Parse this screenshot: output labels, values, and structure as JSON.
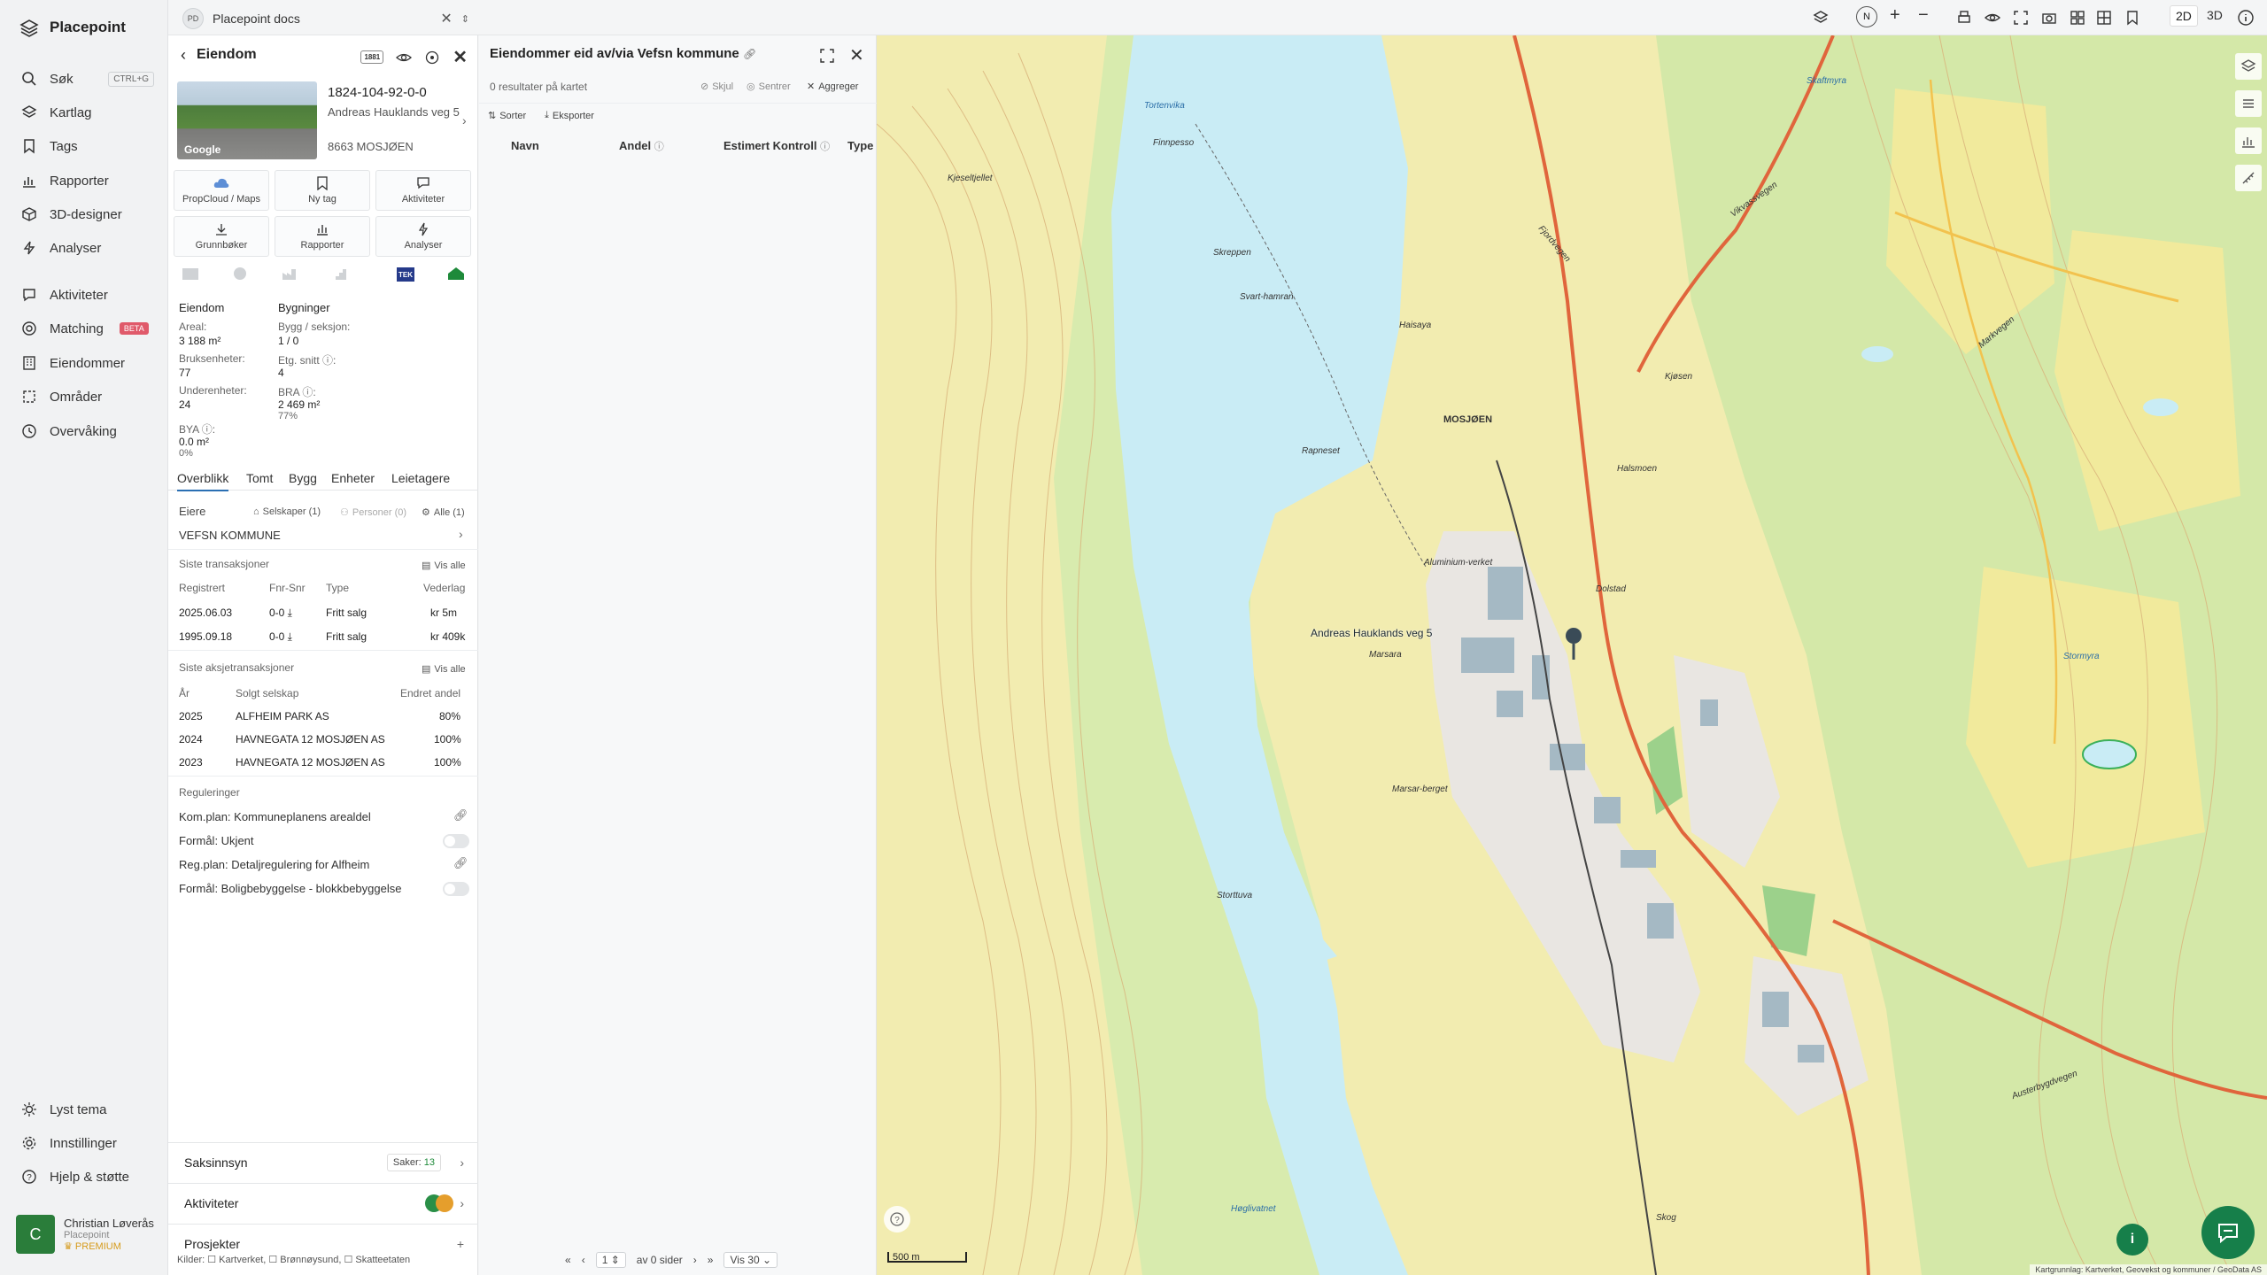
{
  "app": {
    "name": "Placepoint"
  },
  "nav": {
    "items": [
      {
        "label": "Søk",
        "shortcut": "CTRL+G"
      },
      {
        "label": "Kartlag"
      },
      {
        "label": "Tags"
      },
      {
        "label": "Rapporter"
      },
      {
        "label": "3D-designer"
      },
      {
        "label": "Analyser"
      },
      {
        "label": "Aktiviteter"
      },
      {
        "label": "Matching",
        "badge": "BETA"
      },
      {
        "label": "Eiendommer"
      },
      {
        "label": "Områder"
      },
      {
        "label": "Overvåking"
      }
    ],
    "bottom": [
      {
        "label": "Lyst tema"
      },
      {
        "label": "Innstillinger"
      },
      {
        "label": "Hjelp & støtte"
      }
    ],
    "user": {
      "initial": "C",
      "name": "Christian Løverås",
      "org": "Placepoint",
      "plan": "PREMIUM"
    }
  },
  "topbar": {
    "tab": {
      "badge": "PD",
      "title": "Placepoint docs"
    },
    "view_2d": "2D",
    "view_3d": "3D",
    "compass": "N"
  },
  "property": {
    "header": "Eiendom",
    "badge": "1881",
    "photo_logo": "Google",
    "id": "1824-104-92-0-0",
    "address": "Andreas Hauklands veg 5",
    "postal": "8663 MOSJØEN",
    "actions": [
      {
        "label": "PropCloud / Maps"
      },
      {
        "label": "Ny tag"
      },
      {
        "label": "Aktiviteter"
      },
      {
        "label": "Grunnbøker"
      },
      {
        "label": "Rapporter"
      },
      {
        "label": "Analyser"
      }
    ],
    "source_badge": "TEK",
    "summary": {
      "col1_title": "Eiendom",
      "col2_title": "Bygninger",
      "areal_label": "Areal:",
      "areal_value": "3 188 m²",
      "bruk_label": "Bruksenheter:",
      "bruk_value": "77",
      "under_label": "Underenheter:",
      "under_value": "24",
      "bya_label": "BYA ⓘ:",
      "bya_value": "0.0 m²",
      "bya_pct": "0%",
      "bygg_label": "Bygg / seksjon:",
      "bygg_value": "1 / 0",
      "etg_label": "Etg. snitt ⓘ:",
      "etg_value": "4",
      "bra_label": "BRA ⓘ:",
      "bra_value": "2 469 m²",
      "bra_pct": "77%"
    },
    "tabs": [
      "Overblikk",
      "Tomt",
      "Bygg",
      "Enheter",
      "Leietagere"
    ],
    "owners": {
      "title": "Eiere",
      "companies": "Selskaper (1)",
      "persons": "Personer (0)",
      "all": "Alle (1)",
      "owner": "VEFSN KOMMUNE"
    },
    "transactions": {
      "title": "Siste transaksjoner",
      "view_all": "Vis alle",
      "headers": [
        "Registrert",
        "Fnr-Snr",
        "Type",
        "Vederlag"
      ],
      "rows": [
        {
          "date": "2025.06.03",
          "fnr": "0-0",
          "type": "Fritt salg",
          "amount": "kr 5m"
        },
        {
          "date": "1995.09.18",
          "fnr": "0-0",
          "type": "Fritt salg",
          "amount": "kr 409k"
        }
      ]
    },
    "share_tx": {
      "title": "Siste aksjetransaksjoner",
      "view_all": "Vis alle",
      "headers": [
        "År",
        "Solgt selskap",
        "Endret andel"
      ],
      "rows": [
        {
          "year": "2025",
          "company": "ALFHEIM PARK AS",
          "share": "80%"
        },
        {
          "year": "2024",
          "company": "HAVNEGATA 12 MOSJØEN AS",
          "share": "100%"
        },
        {
          "year": "2023",
          "company": "HAVNEGATA 12 MOSJØEN AS",
          "share": "100%"
        }
      ]
    },
    "regulations": {
      "title": "Reguleringer",
      "items": [
        "Kom.plan: Kommuneplanens arealdel",
        "Formål: Ukjent",
        "Reg.plan: Detaljregulering for Alfheim",
        "Formål: Boligbebyggelse - blokkbebyggelse"
      ]
    },
    "accordions": [
      {
        "label": "Saksinnsyn",
        "extra_label": "Saker:",
        "extra_value": "13"
      },
      {
        "label": "Aktiviteter"
      },
      {
        "label": "Prosjekter"
      }
    ],
    "sources_text": "Kilder: ☐ Kartverket, ☐ Brønnøysund, ☐ Skatteetaten"
  },
  "list": {
    "title": "Eiendommer eid av/via Vefsn kommune",
    "count": "0 resultater på kartet",
    "hide": "Skjul",
    "center": "Sentrer",
    "aggregate": "Aggreger",
    "sort": "Sorter",
    "export": "Eksporter",
    "columns": [
      "Navn",
      "Andel",
      "Estimert Kontroll",
      "Type"
    ],
    "pager": {
      "page": "1",
      "of": "av 0 sider",
      "per_page": "Vis 30"
    }
  },
  "map": {
    "town": "MOSJØEN",
    "marker_label": "Andreas Hauklands veg 5",
    "scale": "500 m",
    "attribution": "Kartgrunnlag: Kartverket, Geovekst og kommuner / GeoData AS",
    "labels": {
      "tortenvika": "Tortenvika",
      "finnpesso": "Finnpesso",
      "kjeseltjellet": "Kjeseltjellet",
      "skreppen": "Skreppen",
      "svarthamran": "Svart-hamran",
      "haisaya": "Haisaya",
      "rapneset": "Rapneset",
      "aluminium": "Aluminium-verket",
      "dolstad": "Dolstad",
      "marsara": "Marsara",
      "marsarberget": "Marsar-berget",
      "storttuva": "Storttuva",
      "kjossen": "Kjøsen",
      "halsmoen": "Halsmoen",
      "skaftmyra": "Skaftmyra",
      "vikvassvegen": "Vikvassvegen",
      "fjordvegen": "Fjordvegen",
      "markvegen": "Markvegen",
      "austerbygdvegen": "Austerbygdvegen",
      "stormyra": "Stormyra",
      "hoglivatnet": "Høglivatnet",
      "skog": "Skog"
    }
  }
}
